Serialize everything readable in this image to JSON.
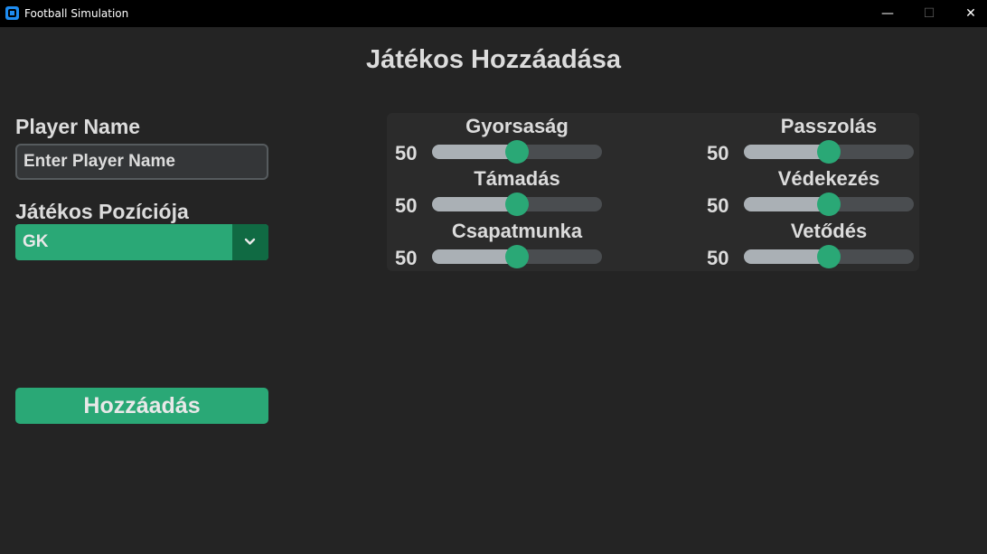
{
  "window": {
    "title": "Football Simulation",
    "minimize": "—",
    "maximize": "☐",
    "close": "✕"
  },
  "header": {
    "title": "Játékos Hozzáadása"
  },
  "form": {
    "name_label": "Player Name",
    "name_placeholder": "Enter Player Name",
    "name_value": "",
    "position_label": "Játékos Pozíciója",
    "position_value": "GK",
    "submit_label": "Hozzáadás"
  },
  "stats": [
    {
      "label": "Gyorsaság",
      "value": "50",
      "level": 0.5
    },
    {
      "label": "Passzolás",
      "value": "50",
      "level": 0.5
    },
    {
      "label": "Támadás",
      "value": "50",
      "level": 0.5
    },
    {
      "label": "Védekezés",
      "value": "50",
      "level": 0.5
    },
    {
      "label": "Csapatmunka",
      "value": "50",
      "level": 0.5
    },
    {
      "label": "Vetődés",
      "value": "50",
      "level": 0.5
    }
  ],
  "colors": {
    "accent": "#2aa876",
    "accent_dark": "#106a43",
    "background": "#242424",
    "panel": "#2b2b2b"
  }
}
